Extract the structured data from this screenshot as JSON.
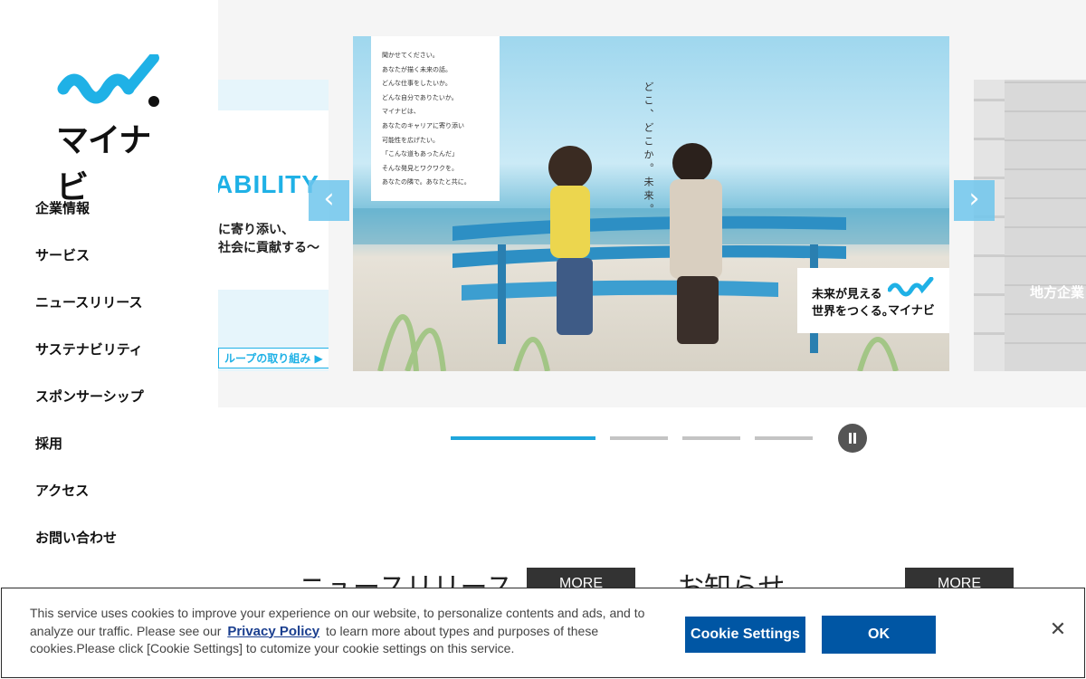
{
  "logo": {
    "text": "マイナビ"
  },
  "nav": [
    "企業情報",
    "サービス",
    "ニュースリリース",
    "サステナビリティ",
    "スポンサーシップ",
    "採用",
    "アクセス",
    "お問い合わせ"
  ],
  "carousel": {
    "prev_slide": {
      "big": "ABILITY",
      "sub_line1": "に寄り添い、",
      "sub_line2": "社会に貢献する～",
      "cta": "ループの取り組み ▶"
    },
    "main_slide": {
      "copy_lines": [
        "聞かせてください。",
        "あなたが描く未来の話。",
        "どんな仕事をしたいか。",
        "どんな自分でありたいか。",
        "マイナビは、",
        "あなたのキャリアに寄り添い",
        "可能性を広げたい。",
        "「こんな道もあったんだ」",
        "そんな発見とワクワクを。",
        "あなたの隣で。あなたと共に。"
      ],
      "vertical": "どこ、どこか。未来。",
      "badge_line1": "未来が見える",
      "badge_line2": "世界をつくる。",
      "badge_logo": "マイナビ"
    },
    "next_slide": {
      "text": "地方企業"
    },
    "arrow_prev": "‹",
    "arrow_next": "›",
    "active_index": 0,
    "slide_count": 4
  },
  "sections": {
    "news_title": "ニュースリリース",
    "notice_title": "お知らせ",
    "more_label": "MORE"
  },
  "cookie": {
    "text_before": "This service uses cookies to improve your experience on our website, to personalize contents and ads, and to analyze our traffic. Please see our",
    "link": "Privacy Policy",
    "text_after": "to learn more about types and purposes of these cookies.Please click [Cookie Settings] to cutomize your cookie settings on this service.",
    "settings_label": "Cookie Settings",
    "ok_label": "OK",
    "close_label": "✕"
  },
  "colors": {
    "brand_cyan": "#1fb1e6",
    "button_blue": "#0056a4",
    "indicator_active": "#1fa6dc"
  }
}
